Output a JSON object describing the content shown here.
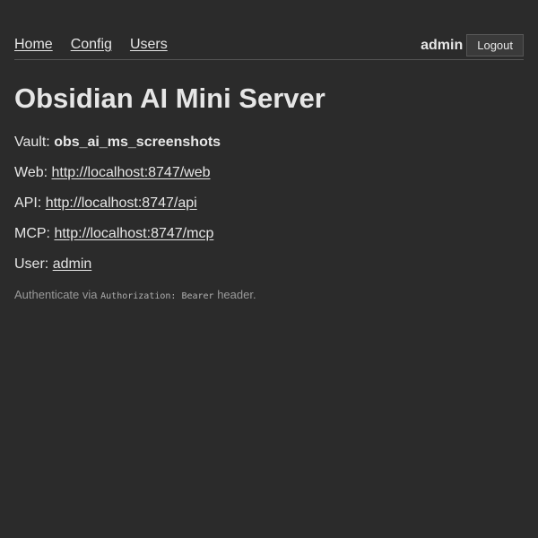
{
  "nav": {
    "home": "Home",
    "config": "Config",
    "users": "Users"
  },
  "account": {
    "username": "admin",
    "logout_label": "Logout"
  },
  "title": "Obsidian AI Mini Server",
  "info": {
    "vault_label": "Vault:",
    "vault_value": "obs_ai_ms_screenshots",
    "web_label": "Web:",
    "web_url": "http://localhost:8747/web",
    "api_label": "API:",
    "api_url": "http://localhost:8747/api",
    "mcp_label": "MCP:",
    "mcp_url": "http://localhost:8747/mcp",
    "user_label": "User:",
    "user_value": "admin"
  },
  "auth_note": {
    "prefix": "Authenticate via",
    "code": "Authorization: Bearer",
    "suffix": "header."
  }
}
